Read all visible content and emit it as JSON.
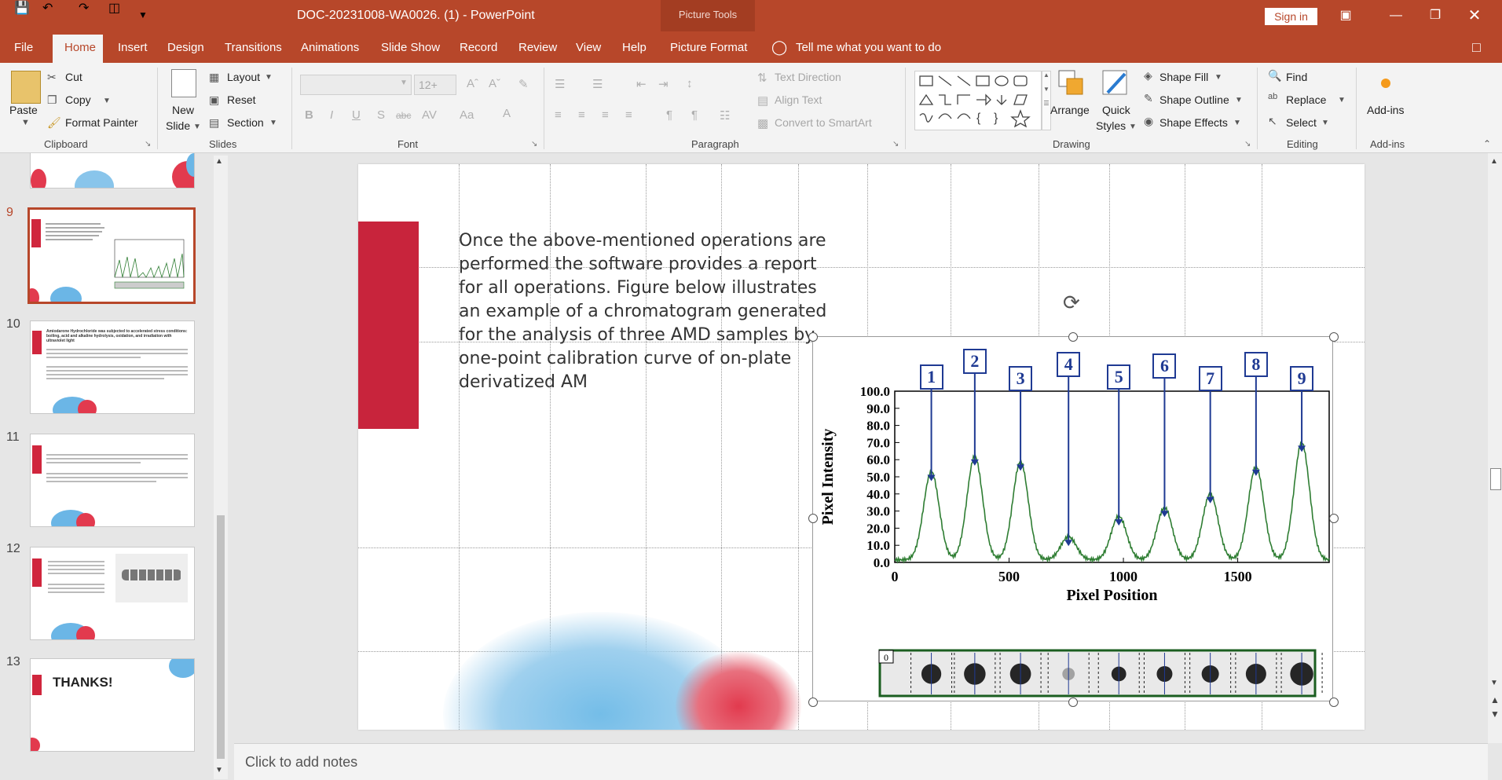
{
  "app": {
    "document_title": "DOC-20231008-WA0026. (1)  -  PowerPoint",
    "context_tools_title": "Picture Tools",
    "signin_label": "Sign in"
  },
  "tabs": [
    "File",
    "Home",
    "Insert",
    "Design",
    "Transitions",
    "Animations",
    "Slide Show",
    "Record",
    "Review",
    "View",
    "Help",
    "Picture Format"
  ],
  "tell_me": "Tell me what you want to do",
  "ribbon": {
    "clipboard": {
      "paste": "Paste",
      "cut": "Cut",
      "copy": "Copy",
      "format_painter": "Format Painter",
      "group": "Clipboard"
    },
    "slides": {
      "new_slide_1": "New",
      "new_slide_2": "Slide",
      "layout": "Layout",
      "reset": "Reset",
      "section": "Section",
      "group": "Slides"
    },
    "font": {
      "size_placeholder": "12+",
      "group": "Font"
    },
    "paragraph": {
      "text_direction": "Text Direction",
      "align_text": "Align Text",
      "convert_smartart": "Convert to SmartArt",
      "group": "Paragraph"
    },
    "drawing": {
      "arrange": "Arrange",
      "quick_styles_1": "Quick",
      "quick_styles_2": "Styles",
      "shape_fill": "Shape Fill",
      "shape_outline": "Shape Outline",
      "shape_effects": "Shape Effects",
      "group": "Drawing"
    },
    "editing": {
      "find": "Find",
      "replace": "Replace",
      "select": "Select",
      "group": "Editing"
    },
    "addins": {
      "label": "Add-ins",
      "group": "Add-ins"
    }
  },
  "thumbnails": [
    {
      "num": "9"
    },
    {
      "num": "10",
      "title": "Amiodarone Hydrochloride was subjected to accelerated stress conditions: boiling, acid and alkaline hydrolysis, oxidation, and irradiation with ultraviolet light"
    },
    {
      "num": "11"
    },
    {
      "num": "12"
    },
    {
      "num": "13",
      "title": "THANKS!"
    }
  ],
  "slide": {
    "body_text": "Once the above-mentioned operations are performed the software provides a report for all operations. Figure below illustrates an example of a chromatogram generated for the analysis of three AMD samples by one-point calibration curve of on-plate derivatized AM"
  },
  "notes_placeholder": "Click to add notes",
  "colors": {
    "accent": "#b7472a",
    "slide_red": "#c8243c",
    "chart_line": "#2e7d32",
    "label_blue": "#1f3a93"
  },
  "chart_data": {
    "type": "line",
    "xlabel": "Pixel Position",
    "ylabel": "Pixel Intensity",
    "xlim": [
      0,
      1900
    ],
    "ylim": [
      0,
      100
    ],
    "x_ticks": [
      "0",
      "500",
      "1000",
      "1500"
    ],
    "y_ticks": [
      "0.0",
      "10.0",
      "20.0",
      "30.0",
      "40.0",
      "50.0",
      "60.0",
      "70.0",
      "80.0",
      "90.0",
      "100.0"
    ],
    "peak_labels": [
      "1",
      "2",
      "3",
      "4",
      "5",
      "6",
      "7",
      "8",
      "9"
    ],
    "peaks": [
      {
        "x": 160,
        "y": 53
      },
      {
        "x": 350,
        "y": 62
      },
      {
        "x": 550,
        "y": 59
      },
      {
        "x": 760,
        "y": 15
      },
      {
        "x": 980,
        "y": 27
      },
      {
        "x": 1180,
        "y": 32
      },
      {
        "x": 1380,
        "y": 40
      },
      {
        "x": 1580,
        "y": 56
      },
      {
        "x": 1780,
        "y": 70
      }
    ],
    "strip_label": "0"
  }
}
